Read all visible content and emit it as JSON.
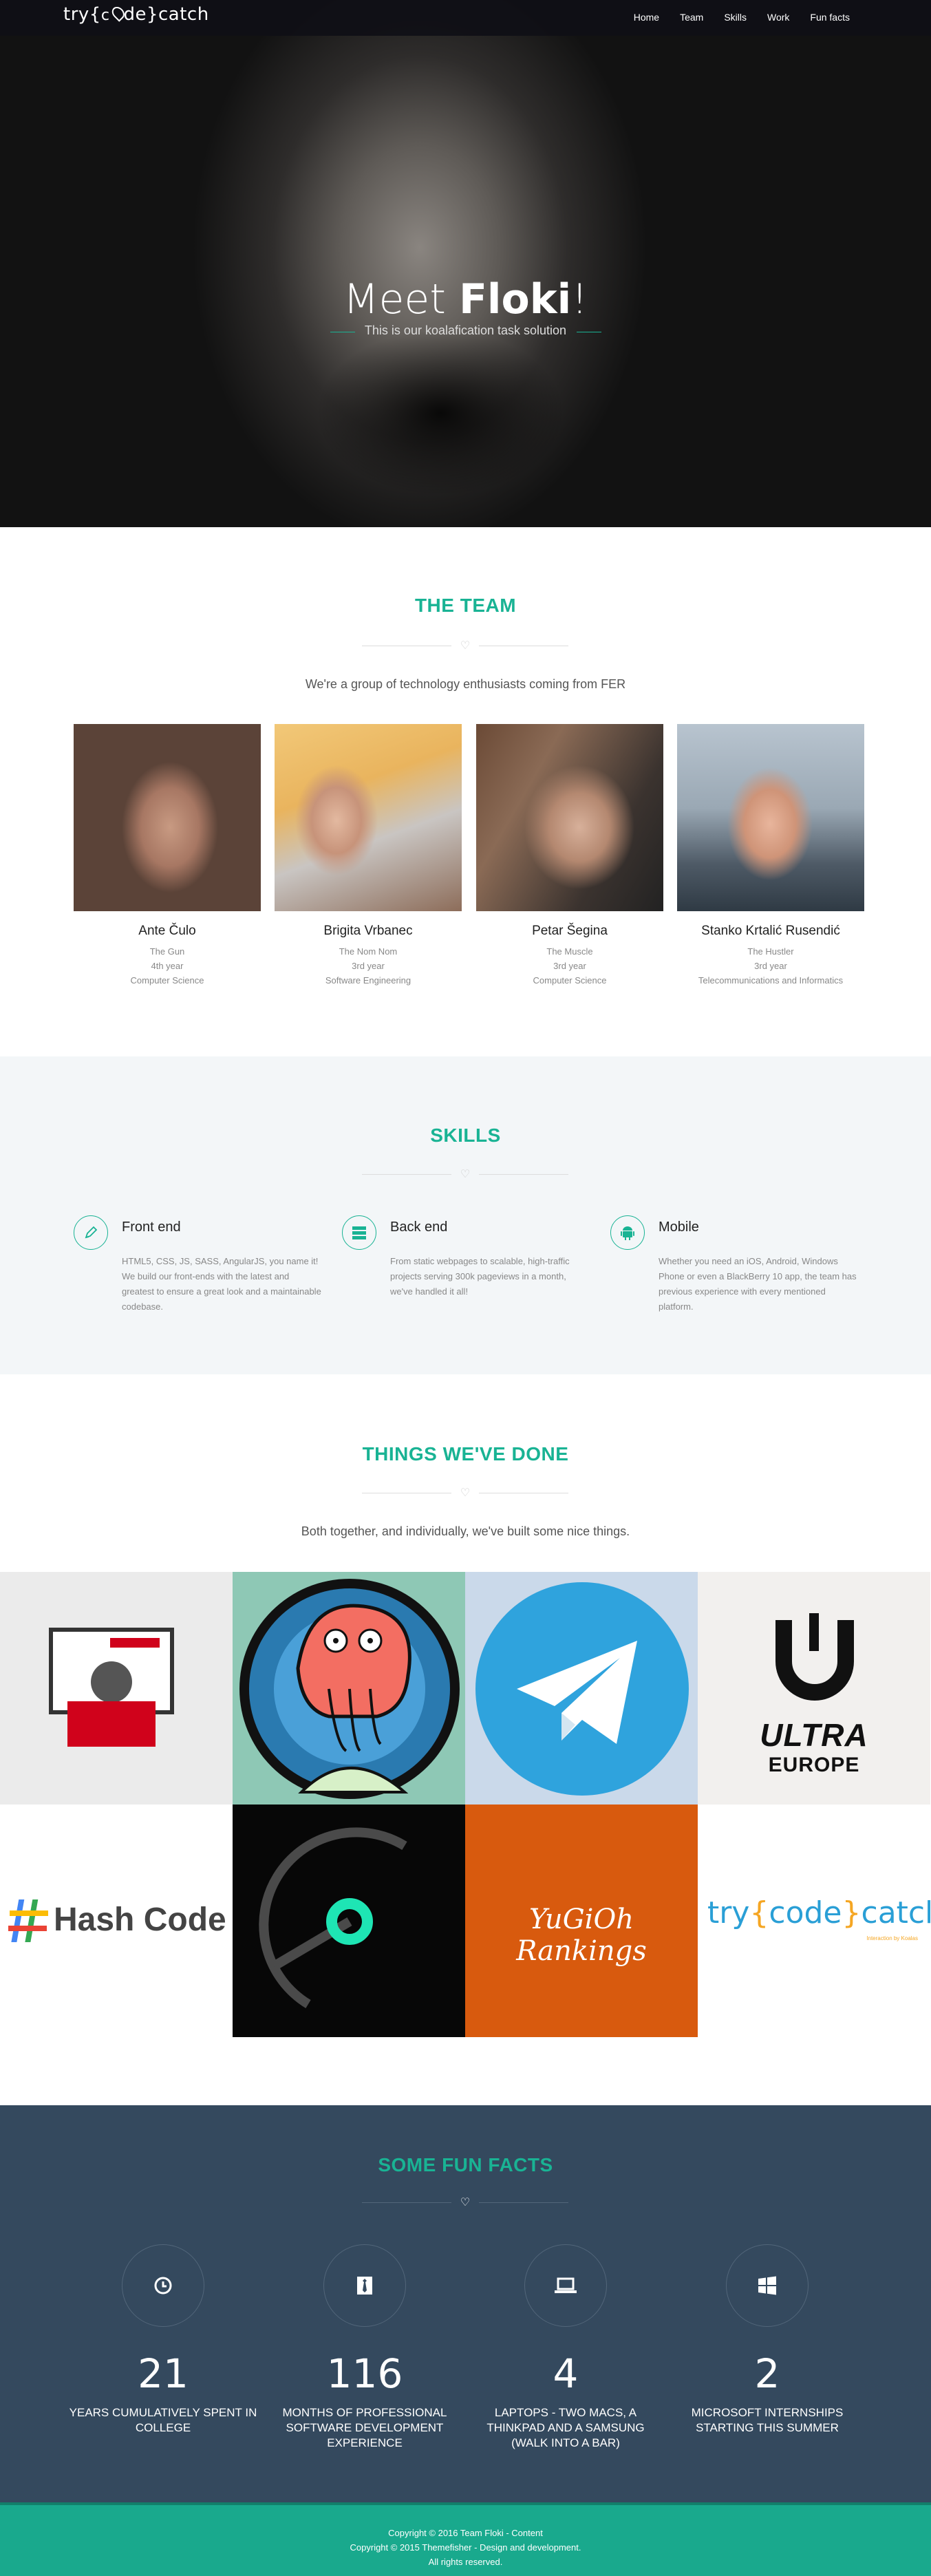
{
  "nav": {
    "logo": {
      "pre": "try",
      "mid": "ode",
      "post": "catch"
    },
    "links": [
      "Home",
      "Team",
      "Skills",
      "Work",
      "Fun facts"
    ]
  },
  "hero": {
    "meet": "Meet ",
    "name": "Floki",
    "bang": "!",
    "subtitle": "This is our koalafication task solution"
  },
  "team": {
    "title": "THE TEAM",
    "subtitle": "We're a group of technology enthusiasts coming from FER",
    "members": [
      {
        "name": "Ante Čulo",
        "role": "The Gun",
        "year": "4th year",
        "field": "Computer Science"
      },
      {
        "name": "Brigita Vrbanec",
        "role": "The Nom Nom",
        "year": "3rd year",
        "field": "Software Engineering"
      },
      {
        "name": "Petar Šegina",
        "role": "The Muscle",
        "year": "3rd year",
        "field": "Computer Science"
      },
      {
        "name": "Stanko Krtalić Rusendić",
        "role": "The Hustler",
        "year": "3rd year",
        "field": "Telecommunications and Informatics"
      }
    ]
  },
  "skills": {
    "title": "SKILLS",
    "items": [
      {
        "icon": "pen-icon",
        "title": "Front end",
        "desc": "HTML5, CSS, JS, SASS, AngularJS, you name it! We build our front-ends with the latest and greatest to ensure a great look and a maintainable codebase."
      },
      {
        "icon": "server-icon",
        "title": "Back end",
        "desc": "From static webpages to scalable, high-traffic projects serving 300k pageviews in a month, we've handled it all!"
      },
      {
        "icon": "android-icon",
        "title": "Mobile",
        "desc": "Whether you need an iOS, Android, Windows Phone or even a BlackBerry 10 app, the team has previous experience with every mentioned platform."
      }
    ]
  },
  "work": {
    "title": "THINGS WE'VE DONE",
    "subtitle": "Both together, and individually, we've built some nice things.",
    "tiles": {
      "ultra_top": "ULTRA",
      "ultra_bottom": "EUROPE",
      "hash_text": "Hash Code",
      "yugioh": "YuGiOh Rankings",
      "tcc_pre": "try",
      "tcc_mid": "code",
      "tcc_post": "catch",
      "tcc_small": "Interaction by Koalas"
    }
  },
  "facts": {
    "title": "SOME FUN FACTS",
    "items": [
      {
        "icon": "clock-icon",
        "number": "21",
        "label": "Years cumulatively spent in college"
      },
      {
        "icon": "tie-icon",
        "number": "116",
        "label": "Months of professional software development experience"
      },
      {
        "icon": "laptop-icon",
        "number": "4",
        "label": "Laptops - two Macs, a Thinkpad and a Samsung (walk into a bar)"
      },
      {
        "icon": "windows-icon",
        "number": "2",
        "label": "Microsoft internships starting this summer"
      }
    ]
  },
  "footer": {
    "line1": "Copyright © 2016 Team Floki - Content",
    "line2": "Copyright © 2015 Themefisher - Design and development.",
    "line3": "All rights reserved."
  },
  "colors": {
    "accent": "#19b394",
    "facts_bg": "#34495e",
    "footer_bg": "#19a98d"
  }
}
